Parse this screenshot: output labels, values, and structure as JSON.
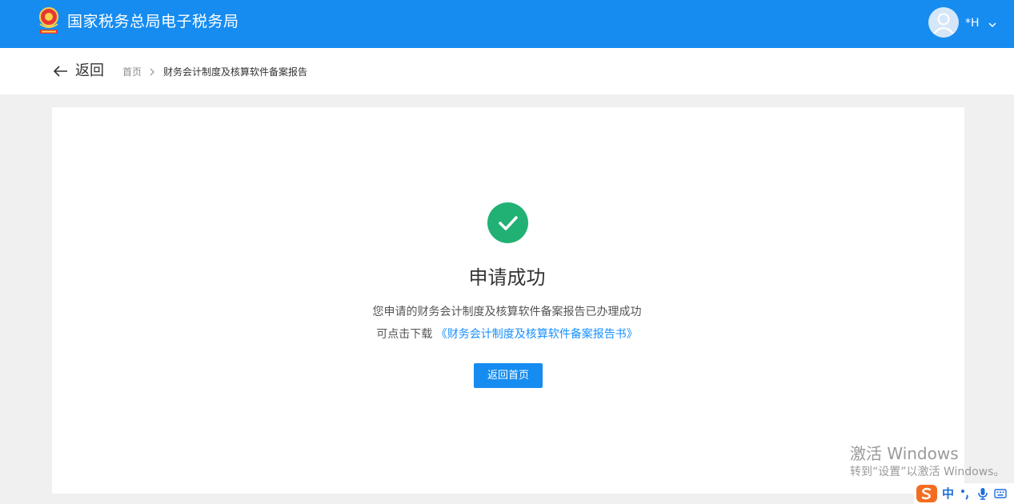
{
  "header": {
    "site_title": "国家税务总局电子税务局",
    "user_name": "*H",
    "brand_color": "#168cf0"
  },
  "nav": {
    "back_label": "返回",
    "breadcrumb": {
      "home": "首页",
      "current": "财务会计制度及核算软件备案报告"
    }
  },
  "result": {
    "status": "success",
    "status_color": "#21b174",
    "title": "申请成功",
    "message": "您申请的财务会计制度及核算软件备案报告已办理成功",
    "download_prefix": "可点击下载",
    "download_link": "《财务会计制度及核算软件备案报告书》",
    "home_button": "返回首页"
  },
  "watermark": {
    "title": "激活 Windows",
    "subtitle": "转到“设置”以激活 Windows。"
  },
  "ime": {
    "language": "中"
  },
  "icons": {
    "logo": "tax-emblem-icon",
    "avatar": "user-avatar-icon",
    "chevron": "chevron-down-icon",
    "back": "arrow-left-icon",
    "breadcrumb_separator": "chevron-right-icon",
    "success": "check-icon",
    "ime_logo": "sogou-s-icon",
    "punctuation": "punctuation-icon",
    "mic": "microphone-icon",
    "keyboard": "keyboard-icon"
  }
}
